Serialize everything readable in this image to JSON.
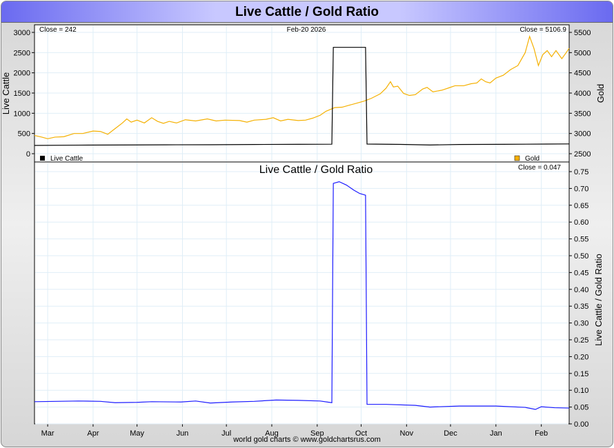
{
  "title": "Live Cattle / Gold Ratio",
  "footer": "world gold charts © www.goldchartsrus.com",
  "colors": {
    "gold": "#f5b000",
    "cattle": "#000000",
    "ratio": "#1a1aff",
    "grid": "#dfeef7"
  },
  "chart_data": [
    {
      "type": "line",
      "title": "",
      "date_label": "Feb-20  2026",
      "ylabel": "Live Cattle",
      "y2label": "Gold",
      "close_left": "Close = 242",
      "close_right": "Close = 5106.9",
      "ylim": [
        0,
        3000
      ],
      "y2lim": [
        2500,
        5500
      ],
      "yticks": [
        "3000",
        "2500",
        "2000",
        "1500",
        "1000",
        "500",
        "0"
      ],
      "y2ticks": [
        "5500",
        "5000",
        "4500",
        "4000",
        "3500",
        "3000",
        "2500"
      ],
      "legend": [
        "Live Cattle",
        "Gold"
      ],
      "series": [
        {
          "name": "Live Cattle",
          "axis": "left",
          "points": [
            [
              0,
              205
            ],
            [
              30,
              212
            ],
            [
              60,
              215
            ],
            [
              90,
              220
            ],
            [
              120,
              222
            ],
            [
              150,
              228
            ],
            [
              180,
              232
            ],
            [
              203,
              235
            ],
            [
              204,
              2630
            ],
            [
              226,
              2630
            ],
            [
              227,
              238
            ],
            [
              250,
              230
            ],
            [
              270,
              215
            ],
            [
              290,
              228
            ],
            [
              320,
              232
            ],
            [
              350,
              238
            ],
            [
              365,
              242
            ]
          ]
        },
        {
          "name": "Gold",
          "axis": "right",
          "points": [
            [
              0,
              2950
            ],
            [
              5,
              2910
            ],
            [
              9,
              2870
            ],
            [
              14,
              2910
            ],
            [
              20,
              2920
            ],
            [
              27,
              3000
            ],
            [
              33,
              3000
            ],
            [
              40,
              3060
            ],
            [
              45,
              3050
            ],
            [
              50,
              2980
            ],
            [
              55,
              3120
            ],
            [
              60,
              3260
            ],
            [
              63,
              3360
            ],
            [
              66,
              3280
            ],
            [
              70,
              3330
            ],
            [
              75,
              3260
            ],
            [
              80,
              3390
            ],
            [
              84,
              3300
            ],
            [
              88,
              3250
            ],
            [
              92,
              3300
            ],
            [
              97,
              3260
            ],
            [
              103,
              3340
            ],
            [
              110,
              3310
            ],
            [
              118,
              3360
            ],
            [
              124,
              3310
            ],
            [
              130,
              3330
            ],
            [
              140,
              3320
            ],
            [
              145,
              3280
            ],
            [
              150,
              3330
            ],
            [
              158,
              3350
            ],
            [
              163,
              3390
            ],
            [
              168,
              3310
            ],
            [
              173,
              3350
            ],
            [
              180,
              3320
            ],
            [
              185,
              3330
            ],
            [
              190,
              3380
            ],
            [
              195,
              3450
            ],
            [
              199,
              3550
            ],
            [
              205,
              3640
            ],
            [
              210,
              3650
            ],
            [
              215,
              3700
            ],
            [
              220,
              3750
            ],
            [
              225,
              3800
            ],
            [
              230,
              3870
            ],
            [
              236,
              3980
            ],
            [
              240,
              4120
            ],
            [
              243,
              4280
            ],
            [
              245,
              4150
            ],
            [
              248,
              4170
            ],
            [
              252,
              3990
            ],
            [
              256,
              3940
            ],
            [
              260,
              3960
            ],
            [
              265,
              4100
            ],
            [
              268,
              4140
            ],
            [
              272,
              4030
            ],
            [
              278,
              4070
            ],
            [
              283,
              4130
            ],
            [
              287,
              4180
            ],
            [
              293,
              4180
            ],
            [
              298,
              4230
            ],
            [
              302,
              4250
            ],
            [
              305,
              4350
            ],
            [
              308,
              4280
            ],
            [
              311,
              4250
            ],
            [
              315,
              4370
            ],
            [
              320,
              4440
            ],
            [
              325,
              4580
            ],
            [
              330,
              4680
            ],
            [
              335,
              5000
            ],
            [
              338,
              5400
            ],
            [
              341,
              5100
            ],
            [
              344,
              4680
            ],
            [
              347,
              4950
            ],
            [
              350,
              5050
            ],
            [
              353,
              4900
            ],
            [
              356,
              5050
            ],
            [
              360,
              4850
            ],
            [
              363,
              5000
            ],
            [
              365,
              5107
            ]
          ]
        }
      ],
      "legend_placement": "bottom"
    },
    {
      "type": "line",
      "title": "Live Cattle  /  Gold Ratio",
      "close": "Close = 0.047",
      "ylabel": "Live Cattle / Gold Ratio",
      "ylim": [
        0,
        0.75
      ],
      "yticks": [
        "0.75",
        "0.70",
        "0.65",
        "0.60",
        "0.55",
        "0.50",
        "0.45",
        "0.40",
        "0.35",
        "0.30",
        "0.25",
        "0.20",
        "0.15",
        "0.10",
        "0.05",
        "0.00"
      ],
      "xticks": [
        "Mar",
        "Apr",
        "May",
        "Jun",
        "Jul",
        "Aug",
        "Sep",
        "Oct",
        "Nov",
        "Dec",
        "Jan",
        "Feb"
      ],
      "xtick_days": [
        9,
        40,
        70,
        101,
        131,
        162,
        193,
        223,
        254,
        284,
        315,
        346
      ],
      "series": [
        {
          "name": "Live Cattle / Gold Ratio",
          "points": [
            [
              0,
              0.066
            ],
            [
              15,
              0.067
            ],
            [
              30,
              0.068
            ],
            [
              45,
              0.067
            ],
            [
              55,
              0.063
            ],
            [
              70,
              0.064
            ],
            [
              80,
              0.066
            ],
            [
              100,
              0.065
            ],
            [
              110,
              0.068
            ],
            [
              120,
              0.062
            ],
            [
              135,
              0.065
            ],
            [
              150,
              0.067
            ],
            [
              165,
              0.071
            ],
            [
              180,
              0.07
            ],
            [
              195,
              0.068
            ],
            [
              203,
              0.063
            ],
            [
              204,
              0.715
            ],
            [
              208,
              0.72
            ],
            [
              213,
              0.71
            ],
            [
              218,
              0.695
            ],
            [
              222,
              0.685
            ],
            [
              226,
              0.68
            ],
            [
              227,
              0.058
            ],
            [
              240,
              0.058
            ],
            [
              260,
              0.055
            ],
            [
              270,
              0.05
            ],
            [
              290,
              0.053
            ],
            [
              315,
              0.053
            ],
            [
              335,
              0.049
            ],
            [
              342,
              0.043
            ],
            [
              346,
              0.051
            ],
            [
              355,
              0.048
            ],
            [
              365,
              0.047
            ]
          ]
        }
      ]
    }
  ]
}
